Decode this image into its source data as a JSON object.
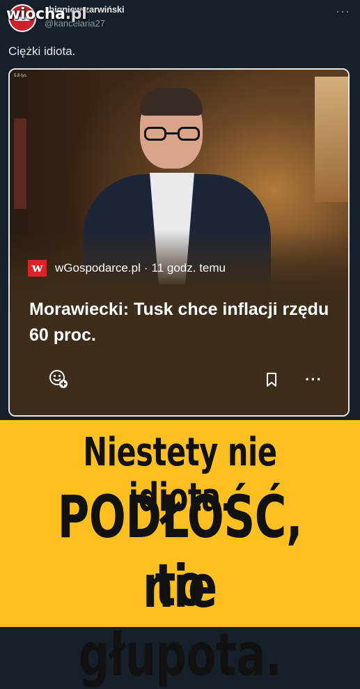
{
  "watermark": {
    "brand": "wiocha",
    "tld": ".pl"
  },
  "tweet": {
    "author_name": "zbigniew•zarwiński",
    "author_handle": "@kancelaria27",
    "text": "Ciężki idiota.",
    "more_label": "···"
  },
  "card": {
    "video_label": "5.8 tys.",
    "source_logo_letter": "w",
    "source_name": "wGospodarce.pl",
    "separator": "·",
    "time": "11 godz. temu",
    "headline": "Morawiecki: Tusk chce inflacji rzędu 60 proc.",
    "icons": [
      "emoji-react-icon",
      "bookmark-icon",
      "more-dots-icon"
    ],
    "more_label": "···"
  },
  "banner": {
    "line1": "Niestety nie idiota.",
    "line2": "PODŁOŚĆ, to",
    "line3": "nie głupota.",
    "background_color": "#fdc020"
  }
}
